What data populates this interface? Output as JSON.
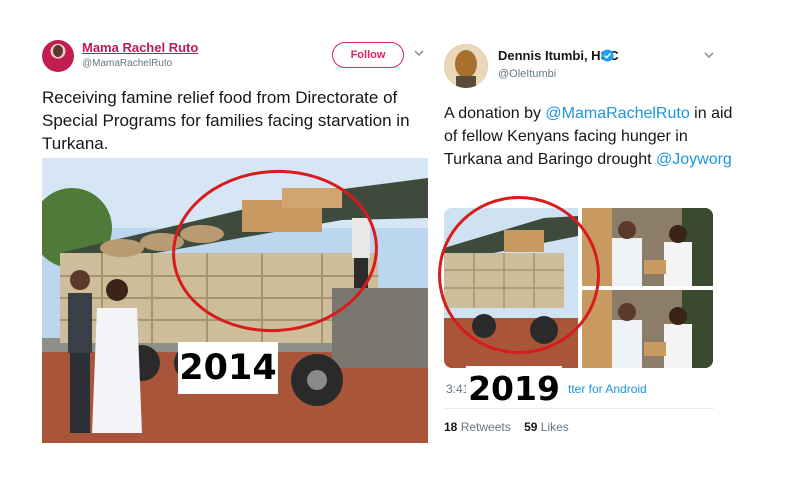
{
  "left_tweet": {
    "name": "Mama Rachel Ruto",
    "handle": "@MamaRachelRuto",
    "follow_label": "Follow",
    "text": "Receiving famine relief food from Directorate of Special Programs for families facing starvation in Turkana.",
    "year_overlay": "2014"
  },
  "right_tweet": {
    "name": "Dennis Itumbi, HSC",
    "handle": "@OleItumbi",
    "text_parts": {
      "prefix": "A donation by ",
      "mention1": "@MamaRachelRuto",
      "middle": " in aid of fellow Kenyans facing hunger in Turkana and Baringo drought ",
      "mention2": "@Joyworg"
    },
    "time": "3:41",
    "source": "tter for Android",
    "retweets_count": "18",
    "retweets_label": "Retweets",
    "likes_count": "59",
    "likes_label": "Likes",
    "year_overlay": "2019"
  },
  "colors": {
    "left_name": "#c2185b",
    "follow_border": "#e0245e",
    "link_blue": "#1b95e0",
    "circle_red": "#d81b1b",
    "muted": "#657786"
  },
  "icons": [
    "chevron-down-icon",
    "verified-badge-icon"
  ]
}
